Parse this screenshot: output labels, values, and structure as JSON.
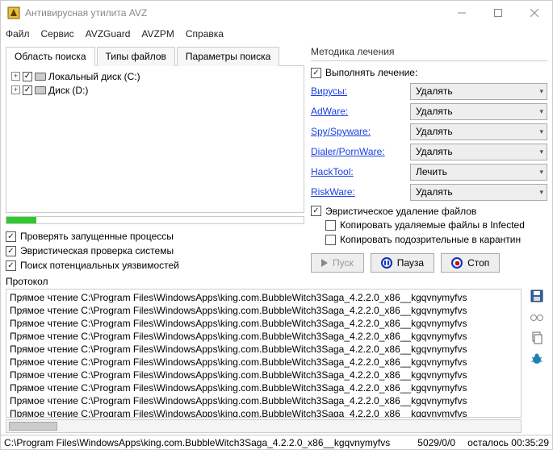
{
  "window": {
    "title": "Антивирусная утилита AVZ"
  },
  "menu": [
    "Файл",
    "Сервис",
    "AVZGuard",
    "AVZPM",
    "Справка"
  ],
  "tabs": [
    "Область поиска",
    "Типы файлов",
    "Параметры поиска"
  ],
  "drives": [
    {
      "label": "Локальный диск (C:)",
      "checked": true
    },
    {
      "label": "Диск (D:)",
      "checked": true
    }
  ],
  "left_checks": [
    {
      "label": "Проверять запущенные процессы",
      "checked": true
    },
    {
      "label": "Эвристическая проверка системы",
      "checked": true
    },
    {
      "label": "Поиск потенциальных уязвимостей",
      "checked": true
    }
  ],
  "treat": {
    "title": "Методика лечения",
    "perform": "Выполнять лечение:",
    "rows": [
      {
        "link": "Вирусы:",
        "value": "Удалять"
      },
      {
        "link": "AdWare:",
        "value": "Удалять"
      },
      {
        "link": "Spy/Spyware:",
        "value": "Удалять"
      },
      {
        "link": "Dialer/PornWare:",
        "value": "Удалять"
      },
      {
        "link": "HackTool:",
        "value": "Лечить"
      },
      {
        "link": "RiskWare:",
        "value": "Удалять"
      }
    ],
    "heur": "Эвристическое удаление файлов",
    "copy_infected": "Копировать удаляемые файлы в  Infected",
    "copy_quarantine": "Копировать подозрительные в  карантин"
  },
  "buttons": {
    "start": "Пуск",
    "pause": "Пауза",
    "stop": "Стоп"
  },
  "protocol": {
    "title": "Протокол",
    "line": "Прямое чтение C:\\Program Files\\WindowsApps\\king.com.BubbleWitch3Saga_4.2.2.0_x86__kgqvnymyfvs",
    "count": 10
  },
  "status": {
    "path": "C:\\Program Files\\WindowsApps\\king.com.BubbleWitch3Saga_4.2.2.0_x86__kgqvnymyfvs",
    "progress": "5029/0/0",
    "eta_label": "осталось",
    "eta_time": "00:35:29"
  }
}
